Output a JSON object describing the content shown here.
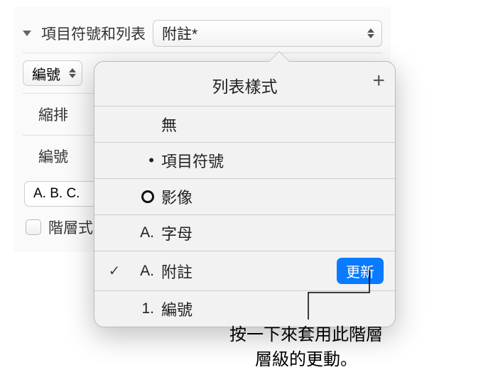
{
  "section": {
    "title": "項目符號和列表",
    "selected_style": "附註*"
  },
  "number_row": {
    "label": "編號"
  },
  "indent": {
    "label": "縮排"
  },
  "number_format": {
    "label": "編號"
  },
  "format_preview": "A. B. C.",
  "hierarchical": {
    "label": "階層式"
  },
  "popover": {
    "title": "列表樣式",
    "items": [
      {
        "prefix": "",
        "name": "無",
        "checked": false
      },
      {
        "prefix": "•",
        "name": "項目符號",
        "checked": false
      },
      {
        "prefix": "circle",
        "name": "影像",
        "checked": false
      },
      {
        "prefix": "A.",
        "name": "字母",
        "checked": false
      },
      {
        "prefix": "A.",
        "name": "附註",
        "checked": true,
        "update": "更新"
      },
      {
        "prefix": "1.",
        "name": "編號",
        "checked": false
      }
    ]
  },
  "callout": {
    "line1": "按一下來套用此階層",
    "line2": "層級的更動。"
  }
}
